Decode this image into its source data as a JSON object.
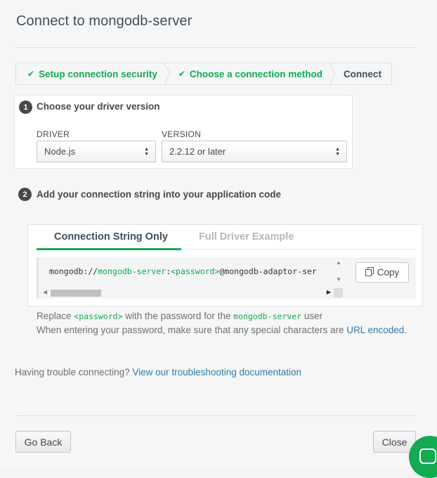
{
  "dialog": {
    "title": "Connect to mongodb-server"
  },
  "steps": [
    {
      "label": "Setup connection security",
      "done": true
    },
    {
      "label": "Choose a connection method",
      "done": true
    },
    {
      "label": "Connect",
      "done": false
    }
  ],
  "section1": {
    "number": "1",
    "heading": "Choose your driver version",
    "driver_label": "DRIVER",
    "driver_value": "Node.js",
    "version_label": "VERSION",
    "version_value": "2.2.12 or later"
  },
  "section2": {
    "number": "2",
    "heading": "Add your connection string into your application code",
    "tabs": [
      {
        "label": "Connection String Only",
        "active": true
      },
      {
        "label": "Full Driver Example",
        "active": false
      }
    ],
    "code": {
      "scheme": "mongodb://",
      "user": "mongodb-server",
      "colon": ":",
      "password": "<password>",
      "host": "@mongodb-adaptor-ser"
    },
    "copy_label": "Copy"
  },
  "note": {
    "replace_prefix": "Replace ",
    "password_token": "<password>",
    "replace_middle": " with the password for the ",
    "user_token": "mongodb-server",
    "replace_suffix": " user",
    "line2_prefix": "When entering your password, make sure that any special characters are ",
    "line2_link": "URL encoded",
    "line2_suffix": "."
  },
  "trouble": {
    "text": "Having trouble connecting?",
    "link": "View our troubleshooting documentation"
  },
  "footer": {
    "back_label": "Go Back",
    "close_label": "Close"
  },
  "colors": {
    "accent_green": "#13aa52",
    "link_blue": "#2e7ca8"
  }
}
